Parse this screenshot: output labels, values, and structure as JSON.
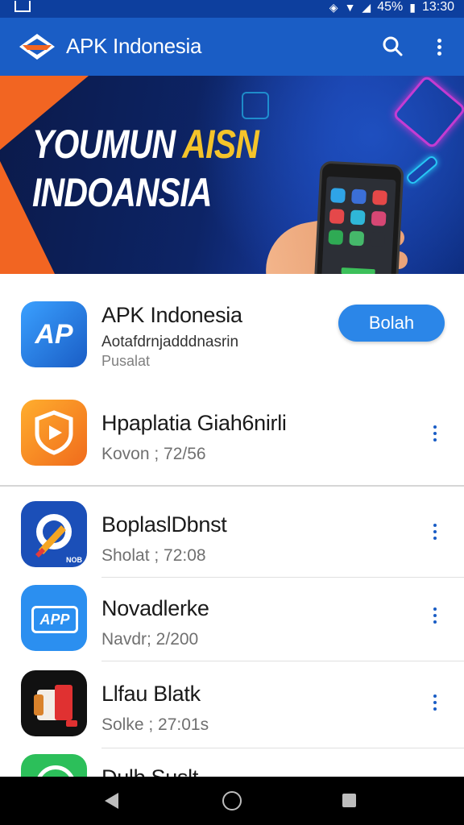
{
  "status_bar": {
    "battery": "45%",
    "time": "13:30"
  },
  "app_bar": {
    "title": "APK Indonesia"
  },
  "banner": {
    "line1_white": "YOUMUN ",
    "line1_yellow": "AISN",
    "line2": "INDOANSIA"
  },
  "featured": {
    "title": "APK Indonesia",
    "line1": "Aotafdrnjadddnasrin",
    "line2": "Pusalat",
    "button_label": "Bolah",
    "icon_text": "AP"
  },
  "apps": [
    {
      "title": "Hpaplatia Giah6nirli",
      "subtitle": "Kovon ; 72/56",
      "icon": "shield-play-icon"
    },
    {
      "title": "BoplaslDbnst",
      "subtitle": "Sholat ; 72:08",
      "icon": "compass-brush-icon",
      "icon_text": "NOB"
    },
    {
      "title": "Novadlerke",
      "subtitle": "Navdr; 2/200",
      "icon": "apk-badge-icon",
      "icon_text": "APP"
    },
    {
      "title": "Llfau Blatk",
      "subtitle": "Solke ; 27:01s",
      "icon": "paint-bucket-icon"
    },
    {
      "title": "Dulb Suslt",
      "subtitle": "",
      "icon": "green-circle-icon"
    }
  ],
  "colors": {
    "primary": "#1a5dc5",
    "status_bar": "#0d3f9e",
    "accent_orange": "#f26522",
    "button_blue": "#2b86e8"
  }
}
